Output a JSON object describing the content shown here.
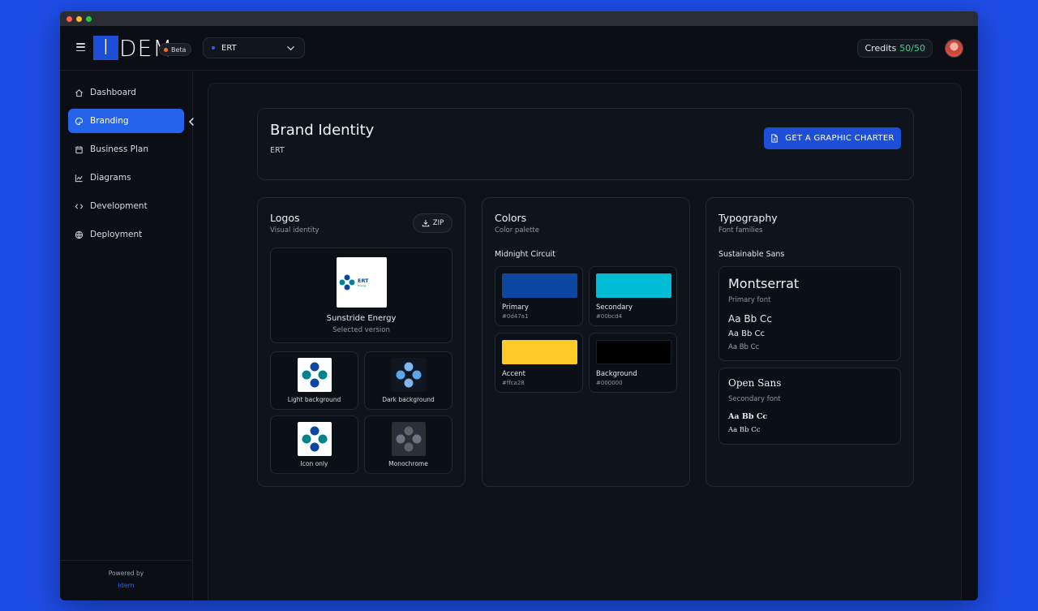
{
  "brand": {
    "logo_first": "I",
    "logo_rest": "DEM",
    "beta": "Beta"
  },
  "project": {
    "name": "ERT"
  },
  "credits": {
    "label": "Credits",
    "value": "50/50"
  },
  "sidebar": {
    "items": [
      {
        "label": "Dashboard",
        "icon": "home-icon"
      },
      {
        "label": "Branding",
        "icon": "palette-icon",
        "active": true
      },
      {
        "label": "Business Plan",
        "icon": "calendar-icon"
      },
      {
        "label": "Diagrams",
        "icon": "chart-line-icon"
      },
      {
        "label": "Development",
        "icon": "code-icon"
      },
      {
        "label": "Deployment",
        "icon": "globe-icon"
      }
    ],
    "powered_by": "Powered by",
    "powered_link": "Idem"
  },
  "hero": {
    "title": "Brand Identity",
    "subtitle": "ERT",
    "button": "GET A GRAPHIC CHARTER"
  },
  "logos": {
    "title": "Logos",
    "subtitle": "Visual identity",
    "zip": "ZIP",
    "selected_name": "Sunstride Energy",
    "selected_sub": "Selected version",
    "logo_word": "ERT",
    "logo_small": "Energy",
    "variants": [
      {
        "label": "Light background"
      },
      {
        "label": "Dark background"
      },
      {
        "label": "Icon only"
      },
      {
        "label": "Monochrome"
      }
    ]
  },
  "colors": {
    "title": "Colors",
    "subtitle": "Color palette",
    "palette_name": "Midnight Circuit",
    "swatches": [
      {
        "name": "Primary",
        "hex": "#0d47a1"
      },
      {
        "name": "Secondary",
        "hex": "#00bcd4"
      },
      {
        "name": "Accent",
        "hex": "#ffca28"
      },
      {
        "name": "Background",
        "hex": "#000000"
      }
    ]
  },
  "typography": {
    "title": "Typography",
    "subtitle": "Font families",
    "family_name": "Sustainable Sans",
    "primary": {
      "name": "Montserrat",
      "role": "Primary font",
      "sample": "Aa Bb Cc"
    },
    "secondary": {
      "name": "Open Sans",
      "role": "Secondary font",
      "sample": "Aa Bb Cc"
    }
  }
}
